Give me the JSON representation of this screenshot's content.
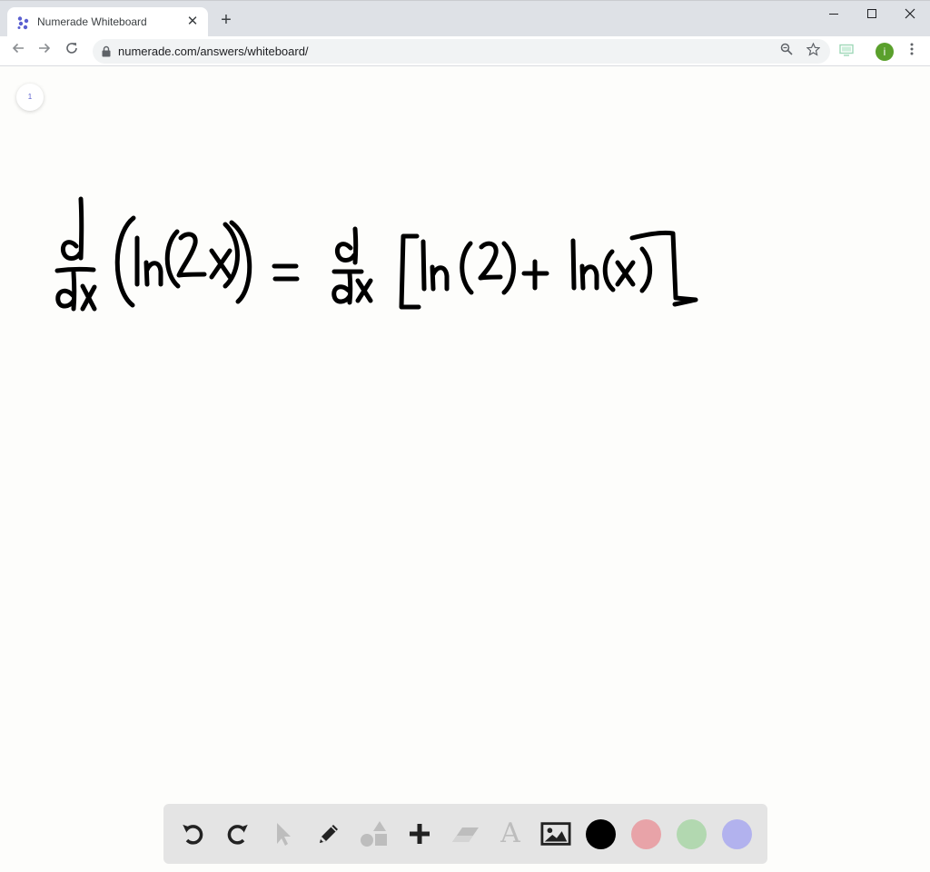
{
  "browser": {
    "tab_title": "Numerade Whiteboard",
    "tab_close": "✕",
    "new_tab": "+",
    "url": "numerade.com/answers/whiteboard/",
    "profile_initial": "i",
    "window_controls": [
      "minimize-icon",
      "maximize-icon",
      "close-icon"
    ]
  },
  "whiteboard": {
    "page_number": "1",
    "handwritten_equation": "d/dx (ln(2x)) = d/dx [ln(2) + ln(x)]",
    "ink_color": "#000000"
  },
  "tools": {
    "items": [
      "undo-icon",
      "redo-icon",
      "select-icon",
      "pen-icon",
      "shapes-icon",
      "add-icon",
      "eraser-icon",
      "text-icon",
      "image-icon"
    ],
    "text_tool_glyph": "A",
    "colors": [
      {
        "name": "black",
        "hex": "#000000",
        "selected": true
      },
      {
        "name": "red",
        "hex": "#e8a3a8",
        "selected": false
      },
      {
        "name": "green",
        "hex": "#b2d8b0",
        "selected": false
      },
      {
        "name": "purple",
        "hex": "#b2b2ee",
        "selected": false
      }
    ]
  }
}
